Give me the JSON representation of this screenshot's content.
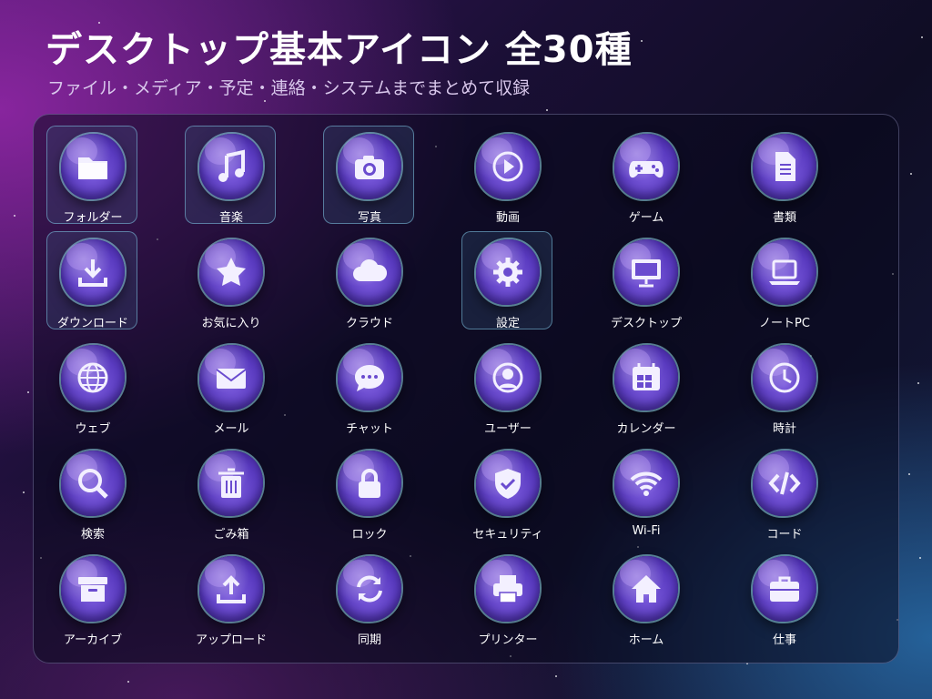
{
  "header": {
    "title": "デスクトップ基本アイコン 全30種",
    "subtitle": "ファイル・メディア・予定・連絡・システムまでまとめて収録"
  },
  "icons": [
    {
      "label": "フォルダー",
      "icon": "folder-icon",
      "selected": true
    },
    {
      "label": "音楽",
      "icon": "music-icon",
      "selected": true
    },
    {
      "label": "写真",
      "icon": "camera-icon",
      "selected": true
    },
    {
      "label": "動画",
      "icon": "play-icon",
      "selected": false
    },
    {
      "label": "ゲーム",
      "icon": "gamepad-icon",
      "selected": false
    },
    {
      "label": "書類",
      "icon": "document-icon",
      "selected": false
    },
    {
      "label": "ダウンロード",
      "icon": "download-icon",
      "selected": true
    },
    {
      "label": "お気に入り",
      "icon": "star-icon",
      "selected": false
    },
    {
      "label": "クラウド",
      "icon": "cloud-icon",
      "selected": false
    },
    {
      "label": "設定",
      "icon": "gear-icon",
      "selected": true
    },
    {
      "label": "デスクトップ",
      "icon": "monitor-icon",
      "selected": false
    },
    {
      "label": "ノートPC",
      "icon": "laptop-icon",
      "selected": false
    },
    {
      "label": "ウェブ",
      "icon": "globe-icon",
      "selected": false
    },
    {
      "label": "メール",
      "icon": "mail-icon",
      "selected": false
    },
    {
      "label": "チャット",
      "icon": "chat-icon",
      "selected": false
    },
    {
      "label": "ユーザー",
      "icon": "user-icon",
      "selected": false
    },
    {
      "label": "カレンダー",
      "icon": "calendar-icon",
      "selected": false
    },
    {
      "label": "時計",
      "icon": "clock-icon",
      "selected": false
    },
    {
      "label": "検索",
      "icon": "search-icon",
      "selected": false
    },
    {
      "label": "ごみ箱",
      "icon": "trash-icon",
      "selected": false
    },
    {
      "label": "ロック",
      "icon": "lock-icon",
      "selected": false
    },
    {
      "label": "セキュリティ",
      "icon": "shield-icon",
      "selected": false
    },
    {
      "label": "Wi-Fi",
      "icon": "wifi-icon",
      "selected": false
    },
    {
      "label": "コード",
      "icon": "code-icon",
      "selected": false
    },
    {
      "label": "アーカイブ",
      "icon": "archive-box-icon",
      "selected": false
    },
    {
      "label": "アップロード",
      "icon": "upload-icon",
      "selected": false
    },
    {
      "label": "同期",
      "icon": "sync-icon",
      "selected": false
    },
    {
      "label": "プリンター",
      "icon": "printer-icon",
      "selected": false
    },
    {
      "label": "ホーム",
      "icon": "home-icon",
      "selected": false
    },
    {
      "label": "仕事",
      "icon": "briefcase-icon",
      "selected": false
    }
  ],
  "colors": {
    "icon_fill": "#f3f0ff",
    "icon_accent": "#6a4bcf",
    "selected_border": "#82c8e6"
  }
}
